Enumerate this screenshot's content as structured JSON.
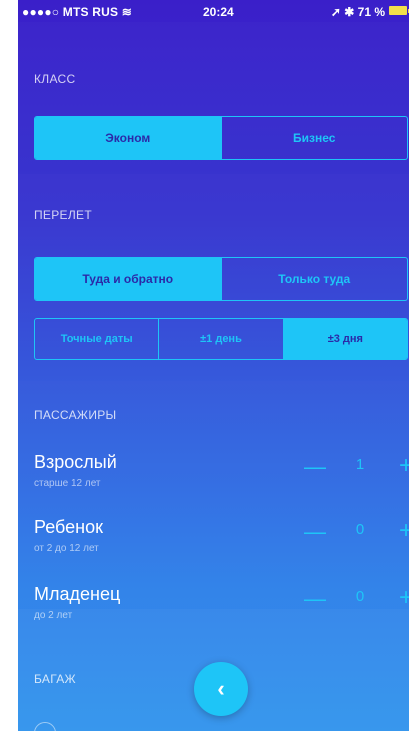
{
  "status_bar": {
    "signal": "●●●●○",
    "carrier": "MTS RUS",
    "time": "20:24",
    "battery": "71 %"
  },
  "class": {
    "title": "КЛАСС",
    "options": [
      "Эконом",
      "Бизнес"
    ],
    "selected": "Эконом"
  },
  "flight": {
    "title": "ПЕРЕЛЕТ",
    "trip_options": [
      "Туда и обратно",
      "Только туда"
    ],
    "trip_selected": "Туда и обратно",
    "date_options": [
      "Точные даты",
      "±1 день",
      "±3 дня"
    ],
    "date_selected": "±3 дня"
  },
  "passengers": {
    "title": "ПАССАЖИРЫ",
    "rows": [
      {
        "name": "Взрослый",
        "sub": "старше 12 лет",
        "count": "1"
      },
      {
        "name": "Ребенок",
        "sub": "от 2 до 12 лет",
        "count": "0"
      },
      {
        "name": "Младенец",
        "sub": "до 2 лет",
        "count": "0"
      }
    ],
    "minus_label": "—",
    "plus_label": "+"
  },
  "baggage": {
    "title": "БАГАЖ"
  },
  "back_button": {
    "label": "‹"
  },
  "colors": {
    "accent": "#1ec5f7",
    "background_top": "#3a1fc9",
    "background_bottom": "#2990ec",
    "battery": "#f2e04b"
  }
}
